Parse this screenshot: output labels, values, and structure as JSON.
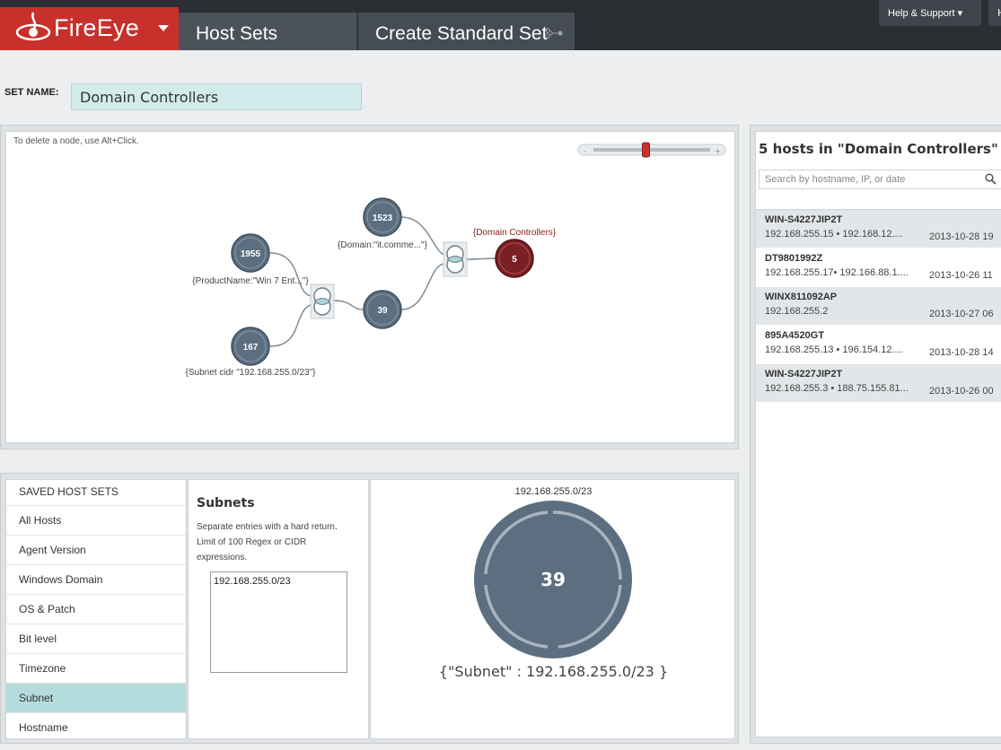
{
  "brand": {
    "name": "FireEye"
  },
  "nav": {
    "tabs": [
      {
        "label": "Host Sets"
      },
      {
        "label": "Create Standard Set"
      }
    ],
    "help": "Help & Support ▾",
    "help2": "H"
  },
  "set_name": {
    "label": "SET NAME:",
    "value": "Domain Controllers"
  },
  "canvas": {
    "hint": "To delete a node, use Alt+Click.",
    "zoom_level": 0.45,
    "nodes": [
      {
        "count": "1955",
        "label": "{ProductName:\"Win 7 Ent...\"}"
      },
      {
        "count": "167",
        "label": "{Subnet cidr \"192.168.255.0/23\"}"
      },
      {
        "count": "39",
        "label": ""
      },
      {
        "count": "1523",
        "label": "{Domain:\"it.comme...\"}"
      },
      {
        "count": "5",
        "label": "{Domain Controllers}"
      }
    ]
  },
  "hosts": {
    "title": "5 hosts in \"Domain Controllers\"",
    "search_placeholder": "Search by hostname, IP, or date",
    "items": [
      {
        "name": "WIN-S4227JIP2T",
        "ip": "192.168.255.15 • 192.168.12....",
        "date": "2013-10-28 19"
      },
      {
        "name": "DT9801992Z",
        "ip": "192.168.255.17• 192.166.88.1....",
        "date": "2013-10-26 11"
      },
      {
        "name": "WINX811092AP",
        "ip": "192.168.255.2",
        "date": "2013-10-27 06"
      },
      {
        "name": "895A4520GT",
        "ip": "192.168.255.13 • 196.154.12....",
        "date": "2013-10-28 14"
      },
      {
        "name": "WIN-S4227JIP2T",
        "ip": "192.168.255.3 • 188.75.155.81...",
        "date": "2013-10-26 00"
      }
    ]
  },
  "attributes": {
    "header": "SAVED HOST SETS",
    "items": [
      {
        "label": "All Hosts"
      },
      {
        "label": "Agent Version"
      },
      {
        "label": "Windows Domain"
      },
      {
        "label": "OS & Patch"
      },
      {
        "label": "Bit level"
      },
      {
        "label": "Timezone"
      },
      {
        "label": "Subnet"
      },
      {
        "label": "Hostname"
      }
    ],
    "active": "Subnet"
  },
  "editor": {
    "title": "Subnets",
    "description": "Separate entries with a hard return. Limit of 100 Regex or CIDR expressions.",
    "value": "192.168.255.0/23"
  },
  "preview": {
    "title": "192.168.255.0/23",
    "count": "39",
    "query": "{\"Subnet\" : 192.168.255.0/23 }"
  },
  "colors": {
    "brand": "#c8302c",
    "topbar": "#2a2f34",
    "node": "#5b6f80",
    "result_node": "#7a1f24",
    "active_row": "#b4dcdc",
    "join_fill": "#a8d6d6"
  }
}
